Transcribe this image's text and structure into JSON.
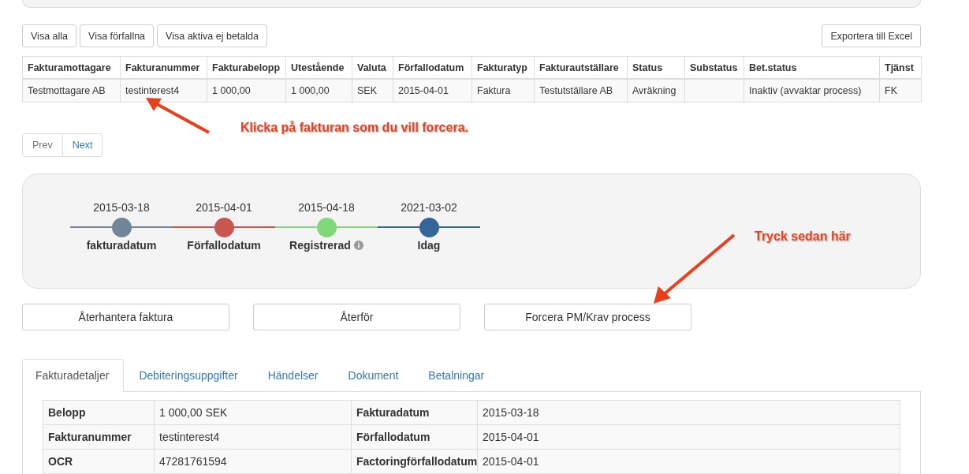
{
  "filters": [
    "Visa alla",
    "Visa förfallna",
    "Visa aktiva ej betalda"
  ],
  "export_button": "Exportera till Excel",
  "invoice_table": {
    "columns": [
      "Fakturamottagare",
      "Fakturanummer",
      "Fakturabelopp",
      "Utestående",
      "Valuta",
      "Förfallodatum",
      "Fakturatyp",
      "Fakturautställare",
      "Status",
      "Substatus",
      "Bet.status",
      "Tjänst"
    ],
    "rows": [
      [
        "Testmottagare AB",
        "testinterest4",
        "1 000,00",
        "1 000,00",
        "SEK",
        "2015-04-01",
        "Faktura",
        "Testutställare AB",
        "Avräkning",
        "",
        "Inaktiv (avvaktar process)",
        "FK"
      ]
    ]
  },
  "pagination": [
    {
      "label": "Prev",
      "disabled": true
    },
    {
      "label": "Next",
      "disabled": false
    }
  ],
  "timeline": [
    {
      "date": "2015-03-18",
      "label": "fakturadatum",
      "color": "#738599",
      "info_icon": false
    },
    {
      "date": "2015-04-01",
      "label": "Förfallodatum",
      "color": "#c9574f",
      "info_icon": false
    },
    {
      "date": "2015-04-18",
      "label": "Registrerad",
      "color": "#80d878",
      "info_icon": true
    },
    {
      "date": "2021-03-02",
      "label": "Idag",
      "color": "#336699",
      "info_icon": false
    }
  ],
  "actions": [
    "Återhantera faktura",
    "Återför",
    "Forcera PM/Krav process"
  ],
  "tabs": [
    {
      "label": "Fakturadetaljer",
      "selected": true
    },
    {
      "label": "Debiteringsuppgifter",
      "selected": false
    },
    {
      "label": "Händelser",
      "selected": false
    },
    {
      "label": "Dokument",
      "selected": false
    },
    {
      "label": "Betalningar",
      "selected": false
    }
  ],
  "details": [
    [
      "Belopp",
      "1 000,00 SEK",
      "Fakturadatum",
      "2015-03-18"
    ],
    [
      "Fakturanummer",
      "testinterest4",
      "Förfallodatum",
      "2015-04-01"
    ],
    [
      "OCR",
      "47281761594",
      "Factoringförfallodatum",
      "2015-04-01"
    ]
  ],
  "annotations": [
    "Klicka på fakturan som du vill forcera.",
    "Tryck sedan här"
  ]
}
